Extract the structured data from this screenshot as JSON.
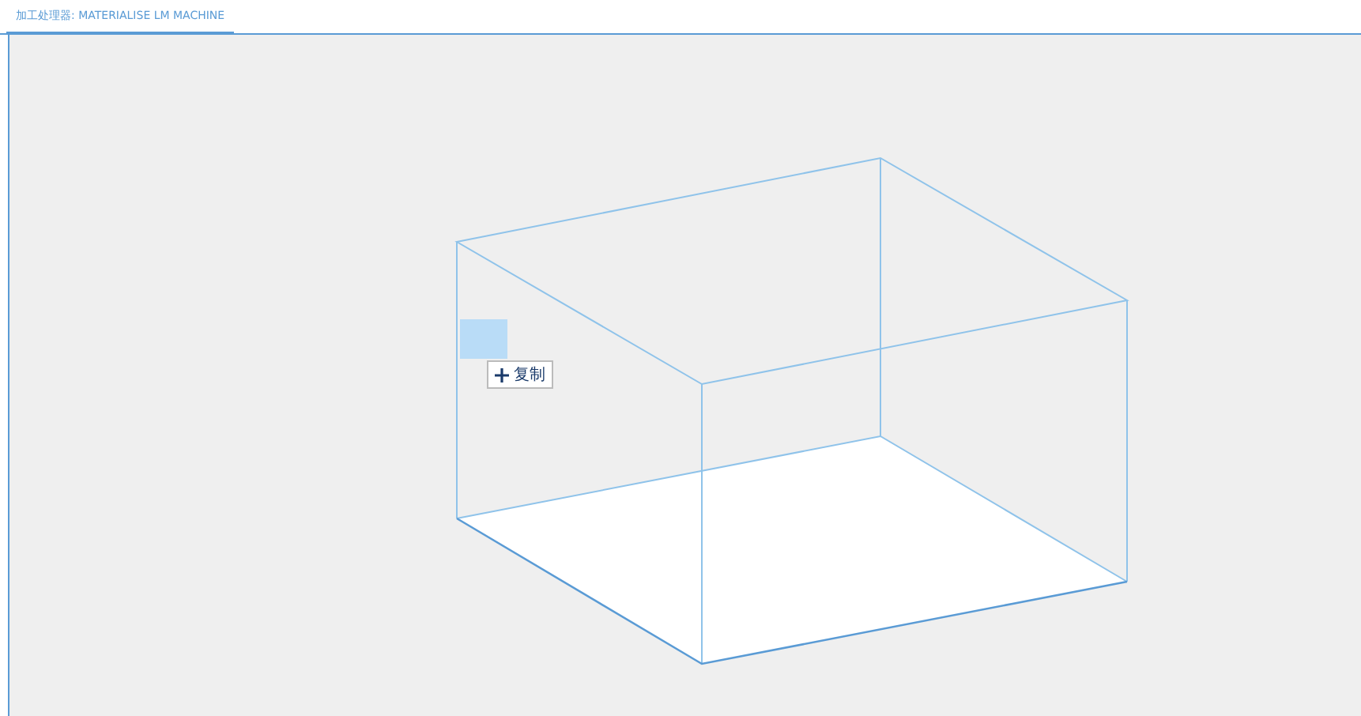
{
  "tabs": [
    {
      "label": "加工处理器: MATERIALISE LM MACHINE",
      "selected": true
    }
  ],
  "drag_tooltip": {
    "label": "复制"
  }
}
